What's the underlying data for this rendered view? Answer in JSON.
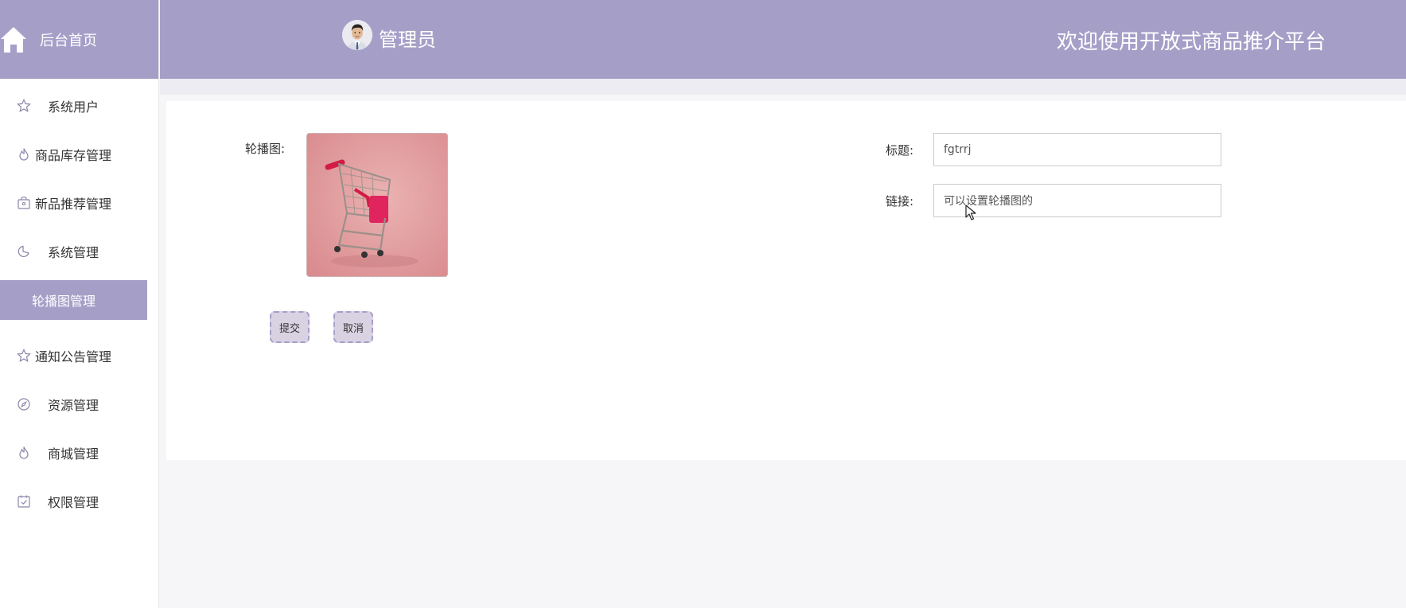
{
  "sidebar": {
    "home_label": "后台首页",
    "items": [
      {
        "label": "系统用户",
        "icon": "star-icon"
      },
      {
        "label": "商品库存管理",
        "icon": "flame-icon"
      },
      {
        "label": "新品推荐管理",
        "icon": "bag-icon"
      },
      {
        "label": "系统管理",
        "icon": "pie-icon"
      },
      {
        "label": "轮播图管理",
        "icon": "",
        "active": true
      },
      {
        "label": "通知公告管理",
        "icon": "star-icon"
      },
      {
        "label": "资源管理",
        "icon": "compass-icon"
      },
      {
        "label": "商城管理",
        "icon": "flame-icon"
      },
      {
        "label": "权限管理",
        "icon": "calendar-check-icon"
      }
    ]
  },
  "header": {
    "admin_name": "管理员",
    "welcome": "欢迎使用开放式商品推介平台"
  },
  "form": {
    "image_label": "轮播图:",
    "title_label": "标题:",
    "title_value": "fgtrrj",
    "link_label": "链接:",
    "link_value": "可以设置轮播图的",
    "submit_label": "提交",
    "cancel_label": "取消"
  },
  "colors": {
    "accent": "#a59fc8",
    "background": "#f6f6f8"
  }
}
